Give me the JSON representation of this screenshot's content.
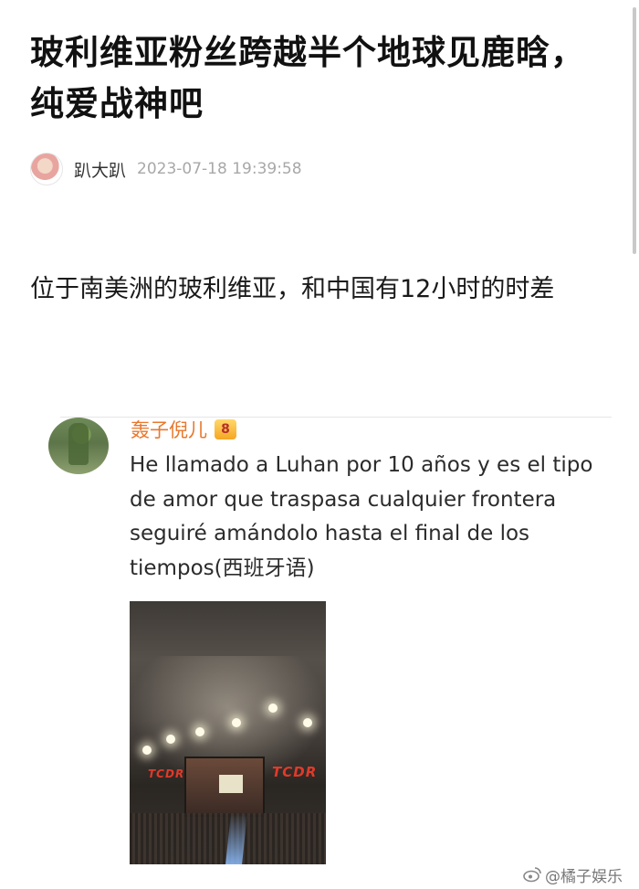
{
  "post": {
    "title": "玻利维亚粉丝跨越半个地球见鹿晗，纯爱战神吧",
    "author": "趴大趴",
    "timestamp": "2023-07-18 19:39:58",
    "body": "位于南美洲的玻利维亚，和中国有12小时的时差"
  },
  "comment": {
    "user": "轰子倪儿",
    "badge_text": "8",
    "text": "He llamado a Luhan por 10 años y es el tipo de amor que traspasa cualquier frontera seguiré amándolo hasta el final de los tiempos(西班牙语)",
    "image_labels": {
      "left": "TCDR",
      "right": "TCDR"
    }
  },
  "watermark": {
    "text": "@橘子娱乐"
  },
  "colors": {
    "commenter_name": "#e8782d",
    "timestamp": "#a8a8a8",
    "text_primary": "#111111"
  },
  "icons": {
    "author_avatar": "avatar-icon",
    "vip_badge": "crown-vip-icon",
    "watermark_logo": "weibo-icon"
  }
}
